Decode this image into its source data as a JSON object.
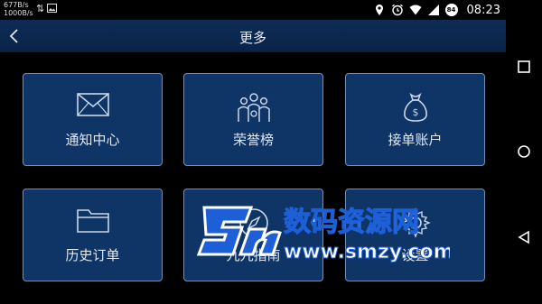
{
  "status_bar": {
    "net_speed_up": "677B/s",
    "net_speed_down": "1000B/s",
    "battery_level": "84",
    "time": "08:23"
  },
  "header": {
    "title": "更多"
  },
  "tiles": [
    {
      "label": "通知中心",
      "icon": "envelope-icon"
    },
    {
      "label": "荣誉榜",
      "icon": "trophy-people-icon"
    },
    {
      "label": "接单账户",
      "icon": "money-bag-icon"
    },
    {
      "label": "历史订单",
      "icon": "folder-icon"
    },
    {
      "label": "九九指南",
      "icon": "compass-icon"
    },
    {
      "label": "设置",
      "icon": "gear-icon"
    }
  ],
  "watermark": {
    "line1": "数码资源网",
    "line2": "www.smzy.com"
  },
  "colors": {
    "tile_bg": "#0f3566",
    "tile_border": "#6f8fb8",
    "header_bg": "#0d2c55",
    "watermark_blue": "#1d5fd6"
  }
}
